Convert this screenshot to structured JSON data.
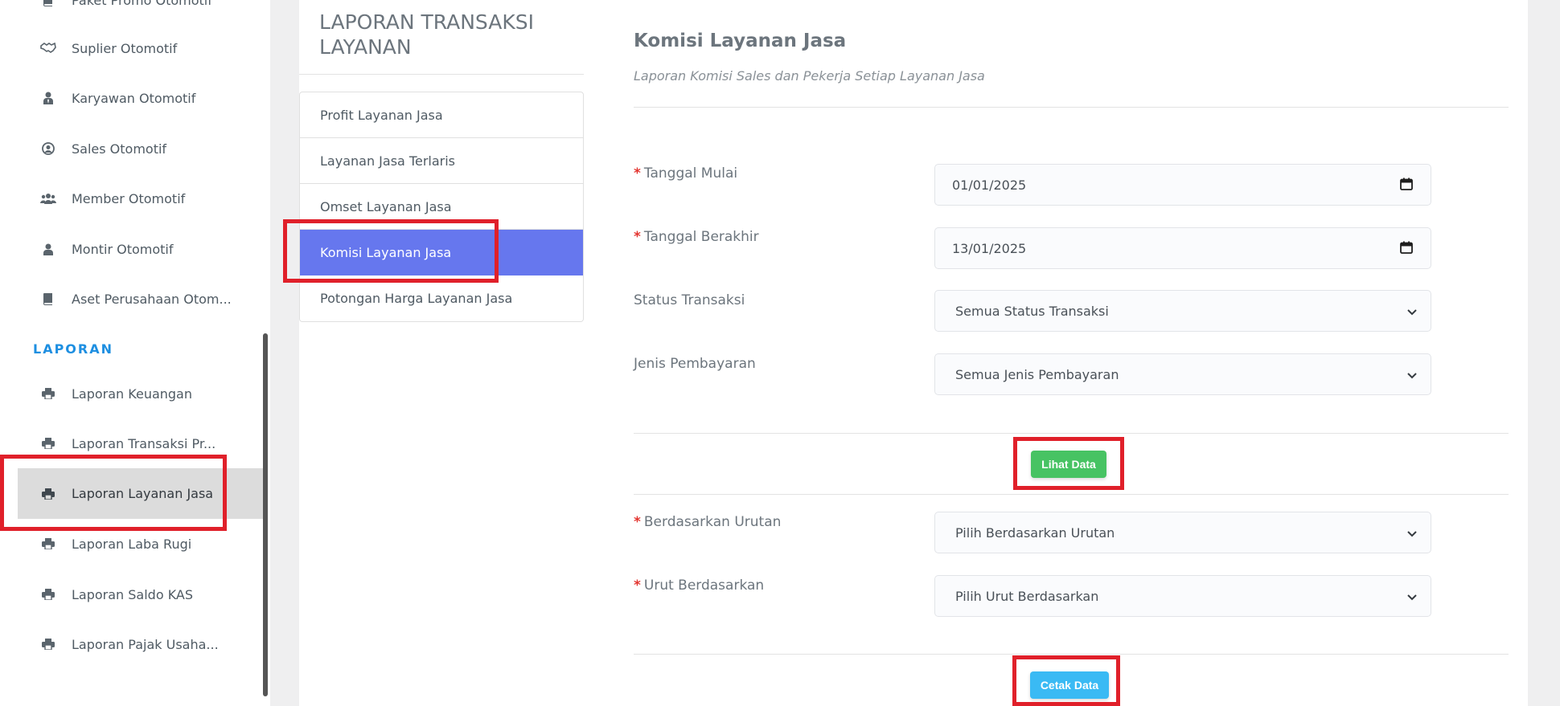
{
  "sidebar": {
    "items": [
      {
        "label": "Paket Promo Otomotif",
        "icon": "book-icon"
      },
      {
        "label": "Suplier Otomotif",
        "icon": "handshake-icon"
      },
      {
        "label": "Karyawan Otomotif",
        "icon": "user-tie-icon"
      },
      {
        "label": "Sales Otomotif",
        "icon": "user-circle-icon"
      },
      {
        "label": "Member Otomotif",
        "icon": "users-icon"
      },
      {
        "label": "Montir Otomotif",
        "icon": "user-icon"
      },
      {
        "label": "Aset Perusahaan Otom...",
        "icon": "book-icon"
      }
    ],
    "section_header": "LAPORAN",
    "report_items": [
      {
        "label": "Laporan Keuangan",
        "icon": "print-icon"
      },
      {
        "label": "Laporan Transaksi Pr...",
        "icon": "print-icon"
      },
      {
        "label": "Laporan Layanan Jasa",
        "icon": "print-icon",
        "active": true
      },
      {
        "label": "Laporan Laba Rugi",
        "icon": "print-icon"
      },
      {
        "label": "Laporan Saldo KAS",
        "icon": "print-icon"
      },
      {
        "label": "Laporan Pajak Usaha...",
        "icon": "print-icon"
      }
    ]
  },
  "report_nav": {
    "title": "LAPORAN TRANSAKSI LAYANAN",
    "items": [
      {
        "label": "Profit Layanan Jasa"
      },
      {
        "label": "Layanan Jasa Terlaris"
      },
      {
        "label": "Omset Layanan Jasa"
      },
      {
        "label": "Komisi Layanan Jasa",
        "active": true
      },
      {
        "label": "Potongan Harga Layanan Jasa"
      }
    ]
  },
  "form": {
    "title": "Komisi Layanan Jasa",
    "subtitle": "Laporan Komisi Sales dan Pekerja Setiap Layanan Jasa",
    "required_mark": "*",
    "start_date": {
      "label": "Tanggal Mulai",
      "value": "01/01/2025"
    },
    "end_date": {
      "label": "Tanggal Berakhir",
      "value": "13/01/2025"
    },
    "status": {
      "label": "Status Transaksi",
      "value": "Semua Status Transaksi"
    },
    "payment": {
      "label": "Jenis Pembayaran",
      "value": "Semua Jenis Pembayaran"
    },
    "view_button": "Lihat Data",
    "sort_basis": {
      "label": "Berdasarkan Urutan",
      "value": "Pilih Berdasarkan Urutan"
    },
    "sort_order": {
      "label": "Urut Berdasarkan",
      "value": "Pilih Urut Berdasarkan"
    },
    "print_button": "Cetak Data"
  },
  "colors": {
    "accent": "#6677ee",
    "section_header": "#1e8fe1",
    "success": "#47c363",
    "info": "#3abaf4",
    "highlight": "#e0202a",
    "required": "#e3342f"
  }
}
